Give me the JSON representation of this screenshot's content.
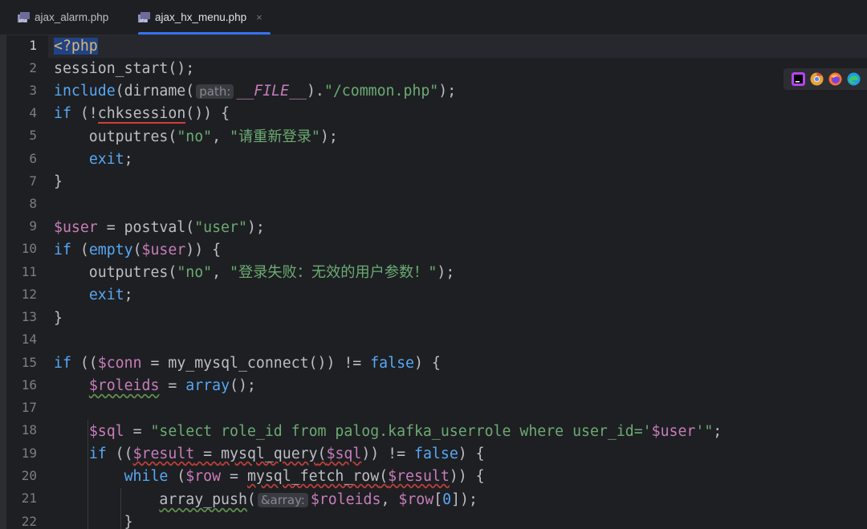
{
  "tabs": [
    {
      "label": "ajax_alarm.php",
      "active": false
    },
    {
      "label": "ajax_hx_menu.php",
      "active": true,
      "close": "×"
    }
  ],
  "hints": {
    "path": "path:",
    "array": "&array:"
  },
  "code": {
    "l1": "<?php",
    "l2a": "session_start",
    "l2b": "();",
    "l3a": "include",
    "l3b": "(",
    "l3c": "dirname",
    "l3d": "(",
    "l3e": "__FILE__",
    "l3f": ").",
    "l3g": "\"/common.php\"",
    "l3h": ");",
    "l4a": "if",
    "l4b": " (!",
    "l4c": "chksession",
    "l4d": "()) {",
    "l5a": "    outputres(",
    "l5b": "\"no\"",
    "l5c": ", ",
    "l5d": "\"请重新登录\"",
    "l5e": ");",
    "l6a": "    ",
    "l6b": "exit",
    "l6c": ";",
    "l7": "}",
    "l9a": "$user",
    "l9b": " = postval(",
    "l9c": "\"user\"",
    "l9d": ");",
    "l10a": "if",
    "l10b": " (",
    "l10c": "empty",
    "l10d": "(",
    "l10e": "$user",
    "l10f": ")) {",
    "l11a": "    outputres(",
    "l11b": "\"no\"",
    "l11c": ", ",
    "l11d": "\"登录失败：无效的用户参数！\"",
    "l11e": ");",
    "l12a": "    ",
    "l12b": "exit",
    "l12c": ";",
    "l13": "}",
    "l15a": "if",
    "l15b": " ((",
    "l15c": "$conn",
    "l15d": " = my_mysql_connect()) != ",
    "l15e": "false",
    "l15f": ") {",
    "l16a": "    ",
    "l16b": "$roleids",
    "l16c": " = ",
    "l16d": "array",
    "l16e": "();",
    "l18a": "    ",
    "l18b": "$sql",
    "l18c": " = ",
    "l18d": "\"select role_id from palog.kafka_userrole where user_id='",
    "l18e": "$user",
    "l18f": "'\"",
    "l18g": ";",
    "l19a": "    ",
    "l19b": "if",
    "l19c": " ((",
    "l19d": "$result",
    "l19e": " = ",
    "l19f": "mysql_query",
    "l19g": "(",
    "l19h": "$sql",
    "l19i": ")) != ",
    "l19j": "false",
    "l19k": ") {",
    "l20a": "        ",
    "l20b": "while",
    "l20c": " (",
    "l20d": "$row",
    "l20e": " = ",
    "l20f": "mysql_fetch_row",
    "l20g": "(",
    "l20h": "$result",
    "l20i": ")) {",
    "l21a": "            ",
    "l21b": "array_push",
    "l21c": "(",
    "l21d": "$roleids",
    "l21e": ", ",
    "l21f": "$row",
    "l21g": "[",
    "l21h": "0",
    "l21i": "]);",
    "l22": "        }"
  },
  "line_numbers": [
    "1",
    "2",
    "3",
    "4",
    "5",
    "6",
    "7",
    "8",
    "9",
    "10",
    "11",
    "12",
    "13",
    "14",
    "15",
    "16",
    "17",
    "18",
    "19",
    "20",
    "21",
    "22"
  ],
  "browser_icons": [
    "phpstorm-icon",
    "chrome-icon",
    "firefox-icon",
    "edge-icon"
  ],
  "colors": {
    "keyword": "#cf8e6d",
    "string": "#6aab73",
    "variable": "#c77dbb",
    "accent": "#3574f0"
  }
}
